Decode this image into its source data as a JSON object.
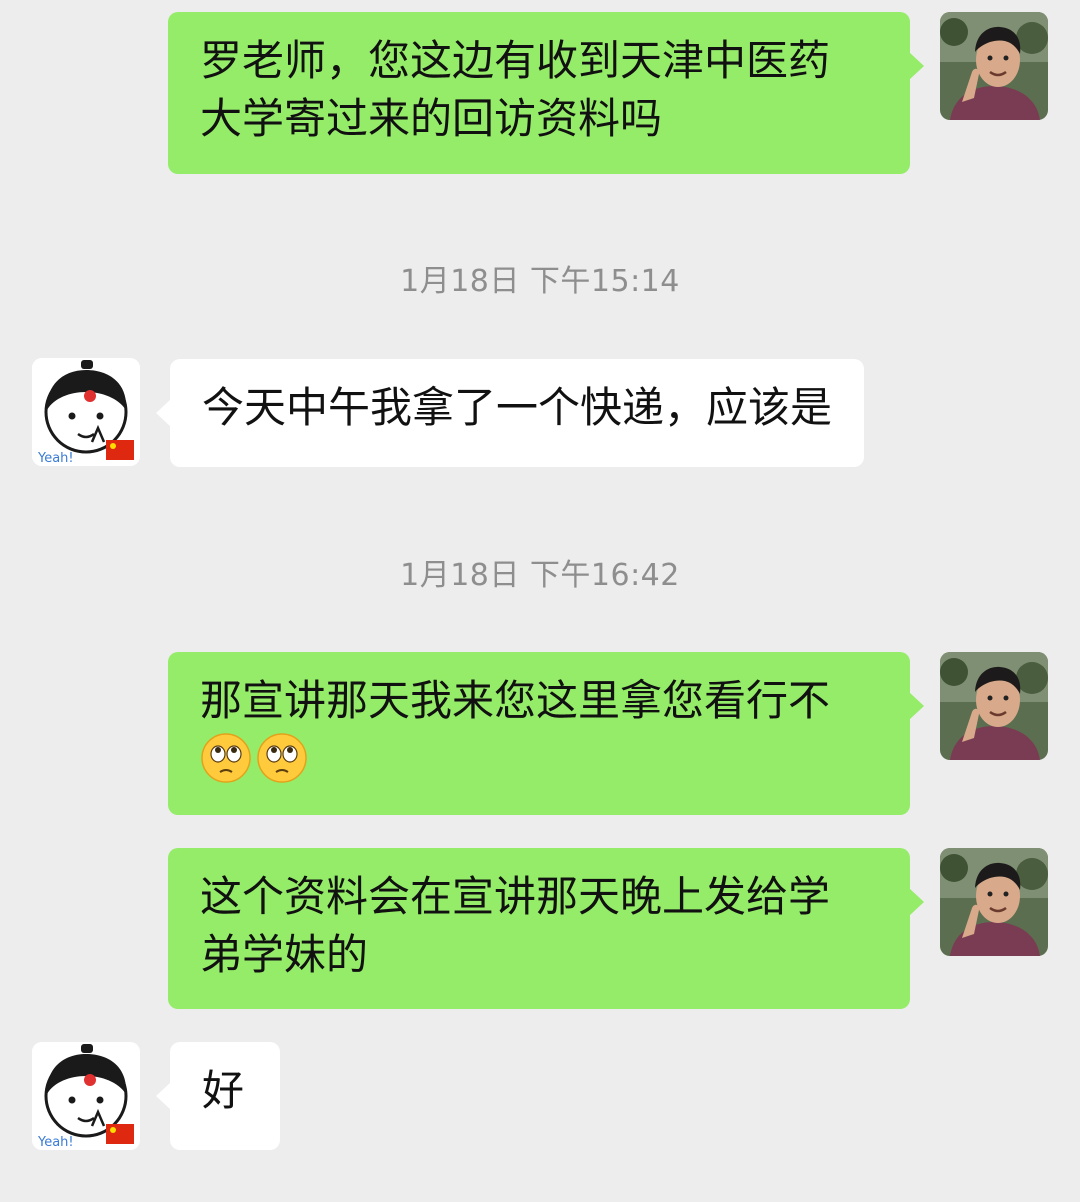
{
  "messages": [
    {
      "sender": "me",
      "lines": [
        "罗老师，您这边有收到天津中医药",
        "大学寄过来的回访资料吗"
      ]
    },
    {
      "timestamp": "1月18日 下午15:14"
    },
    {
      "sender": "friend",
      "lines": [
        "今天中午我拿了一个快递，应该是"
      ]
    },
    {
      "timestamp": "1月18日 下午16:42"
    },
    {
      "sender": "me",
      "lines": [
        "那宣讲那天我来您这里拿您看行不"
      ],
      "emojis": [
        "eye-roll-emoji",
        "eye-roll-emoji"
      ]
    },
    {
      "sender": "me",
      "lines": [
        "这个资料会在宣讲那天晚上发给学",
        "弟学妹的"
      ]
    },
    {
      "sender": "friend",
      "lines": [
        "好"
      ]
    }
  ],
  "friend_avatar_text": "Yeah!",
  "colors": {
    "background": "#ededed",
    "outgoing_bubble": "#95ec69",
    "incoming_bubble": "#ffffff",
    "timestamp_text": "#8e8e8e"
  }
}
